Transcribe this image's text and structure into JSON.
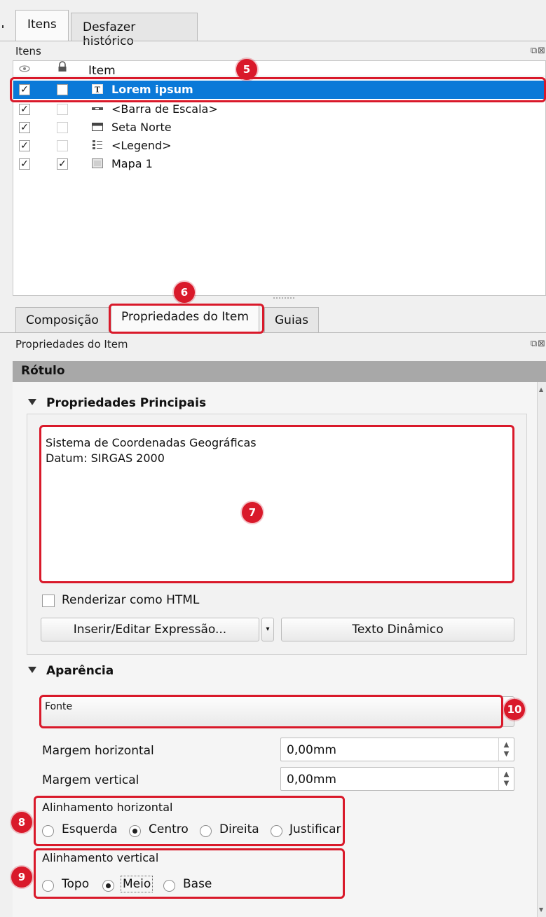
{
  "top_tabs": [
    "Itens",
    "Desfazer histórico"
  ],
  "items_panel": {
    "title": "Itens",
    "float_icons": "⧉⊠",
    "column_item": "Item",
    "rows": [
      {
        "label": "Lorem ipsum",
        "visible": "✓",
        "locked": "",
        "icon": "text-icon",
        "selected": true
      },
      {
        "label": "<Barra de Escala>",
        "visible": "✓",
        "locked": "",
        "icon": "scalebar-icon"
      },
      {
        "label": "Seta Norte",
        "visible": "✓",
        "locked": "",
        "icon": "picture-icon"
      },
      {
        "label": "<Legend>",
        "visible": "✓",
        "locked": "",
        "icon": "legend-icon"
      },
      {
        "label": "Mapa 1",
        "visible": "✓",
        "locked": "✓",
        "icon": "map-icon"
      }
    ]
  },
  "bottom_tabs": [
    "Composição",
    "Propriedades do Item",
    "Guias"
  ],
  "props_panel": {
    "title": "Propriedades do Item",
    "float_icons": "⧉⊠",
    "section": "Rótulo",
    "main_group": "Propriedades Principais",
    "label_text": "Sistema de Coordenadas Geográficas\nDatum: SIRGAS 2000",
    "render_html": "Renderizar como HTML",
    "insert_expression": "Inserir/Editar Expressão...",
    "dynamic_text": "Texto Dinâmico",
    "appearance_group": "Aparência",
    "font_label": "Fonte",
    "margin_h_label": "Margem horizontal",
    "margin_h_value": "0,00mm",
    "margin_v_label": "Margem vertical",
    "margin_v_value": "0,00mm",
    "halign_label": "Alinhamento horizontal",
    "halign_options": [
      "Esquerda",
      "Centro",
      "Direita",
      "Justificar"
    ],
    "halign_selected": "Centro",
    "valign_label": "Alinhamento vertical",
    "valign_options": [
      "Topo",
      "Meio",
      "Base"
    ],
    "valign_selected": "Meio"
  },
  "annotations": [
    "5",
    "6",
    "7",
    "8",
    "9",
    "10"
  ],
  "colors": {
    "selection": "#0a79d8",
    "annotation": "#d9192a",
    "section_bar": "#a8a8a8"
  }
}
